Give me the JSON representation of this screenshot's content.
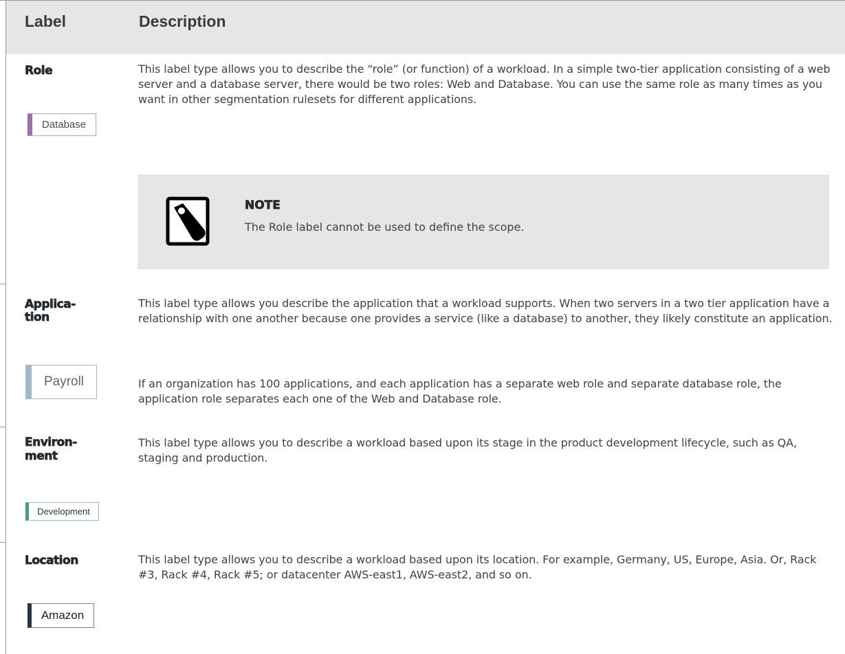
{
  "header": {
    "label": "Label",
    "description": "Description"
  },
  "rows": {
    "role": {
      "label": "Role",
      "chip": "Database",
      "description": "This label type allows you to describe the “role” (or function) of a workload. In a simple two-tier application consisting of a web server and a database server, there would be two roles: Web and Database. You can use the same role as many times as you want in other segmentation rulesets for different applications.",
      "note": {
        "title": "NOTE",
        "text": "The Role label cannot be used to define the scope.",
        "icon": "note-icon"
      }
    },
    "application": {
      "label_line1": "Applica-",
      "label_line2": "tion",
      "chip": "Payroll",
      "description": "This label type allows you describe the application that a workload supports. When two servers in a two tier application have a relationship with one another because one provides a service (like a database) to another, they likely constitute an application.",
      "description2": "If an organization has 100 applications, and each application has a separate web role and separate database role, the application role separates each one of the Web and Database role."
    },
    "environment": {
      "label_line1": "Environ-",
      "label_line2": "ment",
      "chip": "Development",
      "description": "This label type allows you to describe a workload based upon its stage in the product development lifecycle, such as QA, staging and production."
    },
    "location": {
      "label": "Location",
      "chip": "Amazon",
      "description": "This label type allows you to describe a workload based upon its location. For example, Germany, US, Europe, Asia. Or, Rack #3, Rack #4, Rack #5; or datacenter AWS-east1, AWS-east2, and so on."
    }
  },
  "colors": {
    "header_bg": "#e6e6e6",
    "role_accent": "#9b6fb0",
    "application_accent": "#9fb8ca",
    "environment_accent": "#40a08a",
    "location_accent": "#253645"
  }
}
